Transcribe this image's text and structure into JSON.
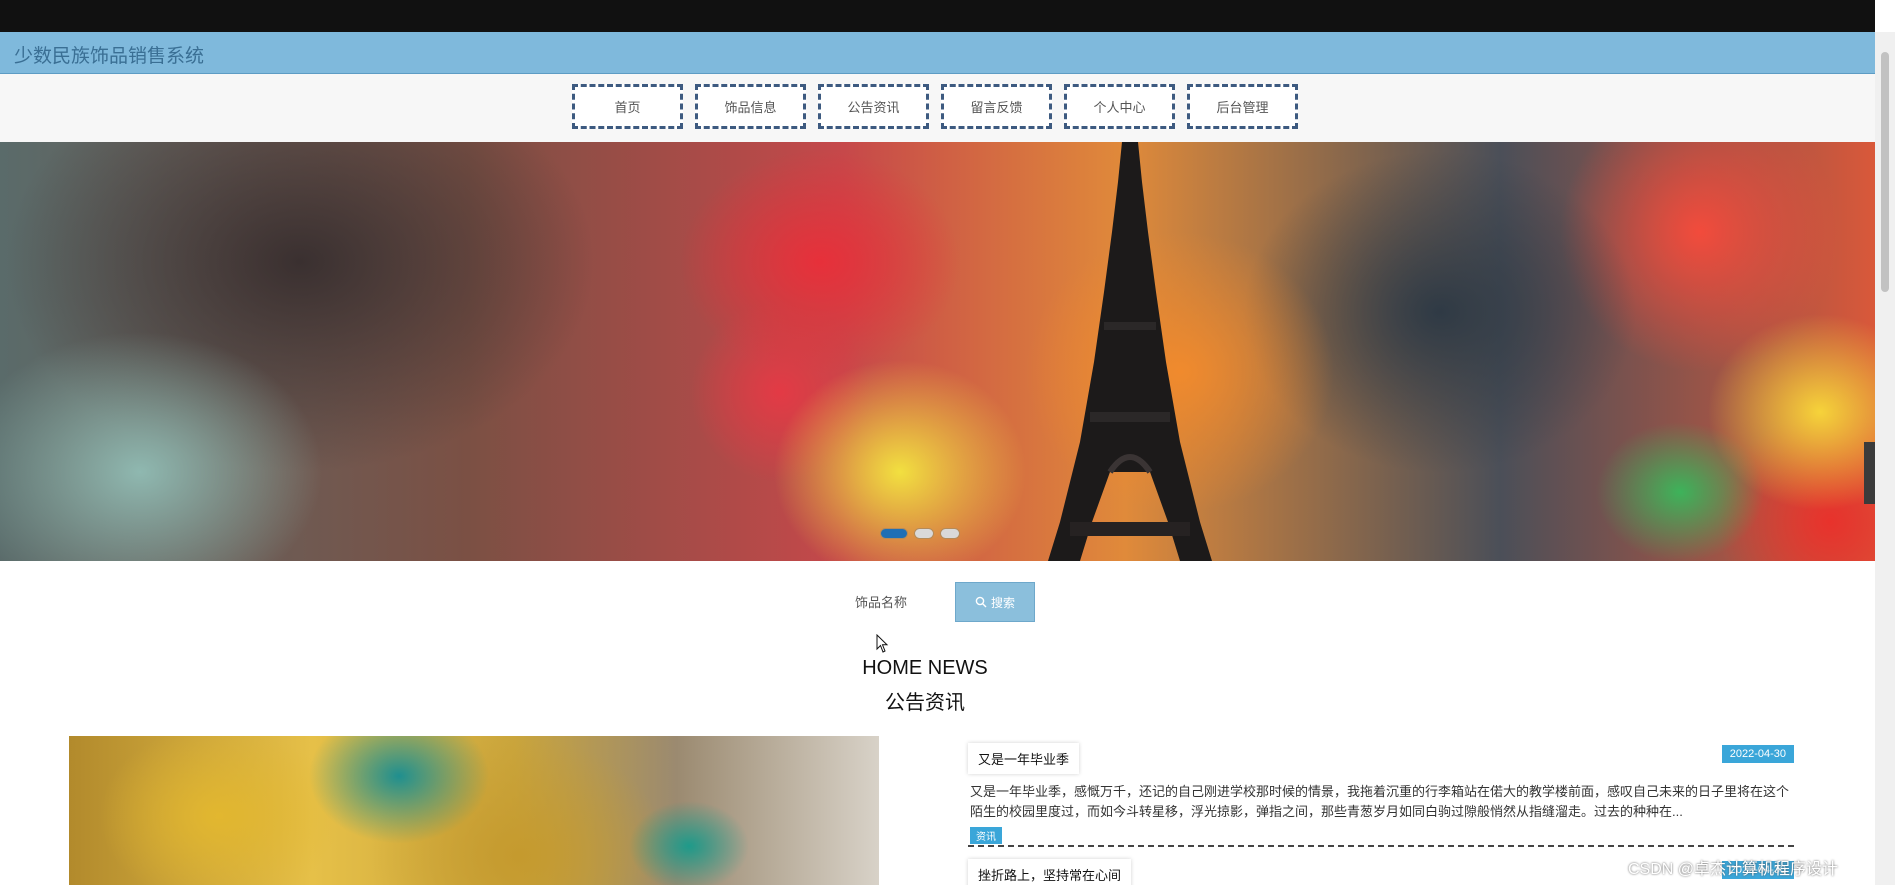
{
  "app": {
    "title": "少数民族饰品销售系统"
  },
  "nav": {
    "items": [
      "首页",
      "饰品信息",
      "公告资讯",
      "留言反馈",
      "个人中心",
      "后台管理"
    ]
  },
  "banner": {
    "dots": 3,
    "active_dot": 0
  },
  "search": {
    "placeholder": "饰品名称",
    "button_label": "搜索"
  },
  "section": {
    "title_en": "HOME NEWS",
    "title_cn": "公告资讯"
  },
  "news": [
    {
      "title": "又是一年毕业季",
      "date": "2022-04-30",
      "body": "又是一年毕业季，感慨万千，还记的自己刚进学校那时候的情景，我拖着沉重的行李箱站在偌大的教学楼前面，感叹自己未来的日子里将在这个陌生的校园里度过，而如今斗转星移，浮光掠影，弹指之间，那些青葱岁月如同白驹过隙般悄然从指缝溜走。过去的种种在...",
      "tag": "资讯"
    },
    {
      "title": "挫折路上，坚持常在心间",
      "date": "2022-04-30"
    }
  ],
  "watermark": "CSDN @卓杰计算机程序设计",
  "colors": {
    "titlebar": "#7fb9dc",
    "accent": "#3aa6d9",
    "nav_border": "#3d5a80"
  }
}
